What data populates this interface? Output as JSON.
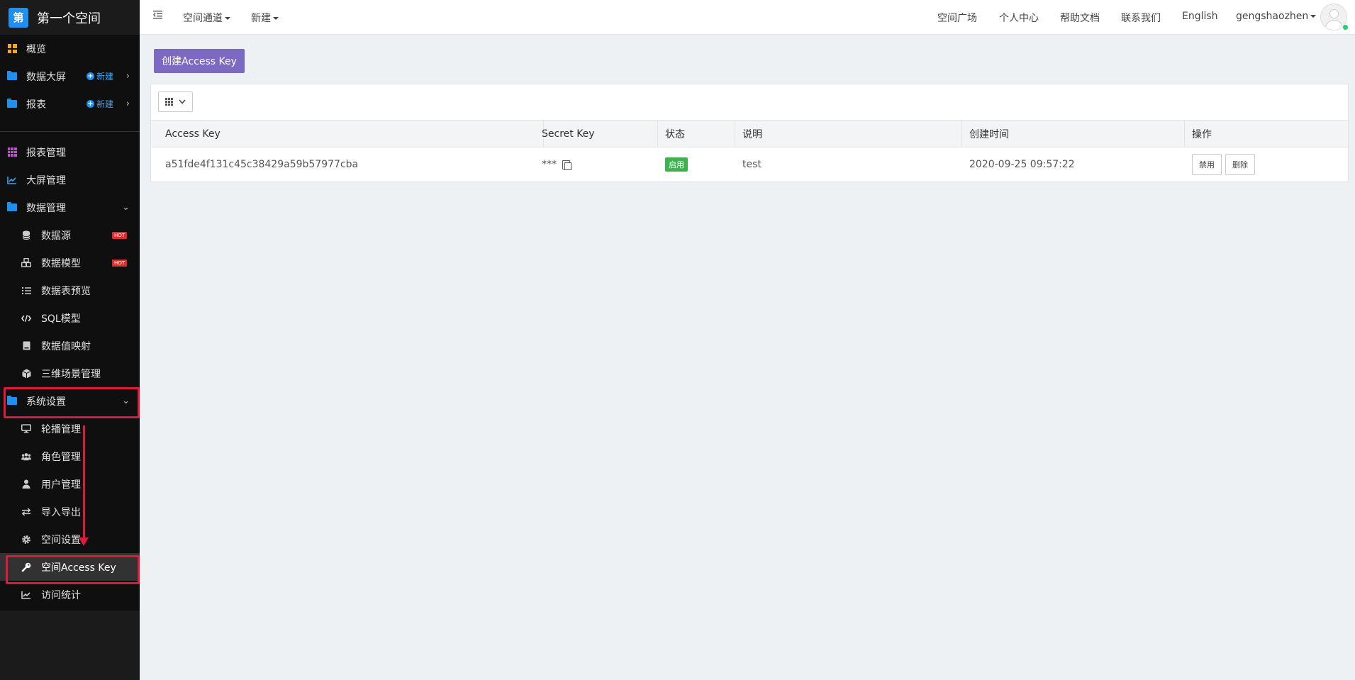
{
  "brand": {
    "logo": "第",
    "name": "第一个空间"
  },
  "sidebar": {
    "new_label": "新建",
    "hot_label": "HOT",
    "items": [
      {
        "label": "概览",
        "icon": "dashboard-grid-icon"
      },
      {
        "label": "数据大屏",
        "icon": "folder-icon"
      },
      {
        "label": "报表",
        "icon": "folder-icon"
      },
      {
        "label": "报表管理",
        "icon": "apps-grid-icon"
      },
      {
        "label": "大屏管理",
        "icon": "line-chart-icon"
      },
      {
        "label": "数据管理",
        "icon": "folder-icon"
      },
      {
        "label": "数据源",
        "icon": "database-icon"
      },
      {
        "label": "数据模型",
        "icon": "cubes-icon"
      },
      {
        "label": "数据表预览",
        "icon": "list-icon"
      },
      {
        "label": "SQL模型",
        "icon": "code-icon"
      },
      {
        "label": "数据值映射",
        "icon": "book-icon"
      },
      {
        "label": "三维场景管理",
        "icon": "cube-icon"
      },
      {
        "label": "系统设置",
        "icon": "folder-icon"
      },
      {
        "label": "轮播管理",
        "icon": "desktop-icon"
      },
      {
        "label": "角色管理",
        "icon": "users-icon"
      },
      {
        "label": "用户管理",
        "icon": "user-icon"
      },
      {
        "label": "导入导出",
        "icon": "exchange-icon"
      },
      {
        "label": "空间设置",
        "icon": "gear-icon"
      },
      {
        "label": "空间Access Key",
        "icon": "key-icon"
      },
      {
        "label": "访问统计",
        "icon": "area-chart-icon"
      }
    ]
  },
  "topbar": {
    "left": [
      "空间通道",
      "新建"
    ],
    "right": [
      "空间广场",
      "个人中心",
      "帮助文档",
      "联系我们",
      "English"
    ],
    "username": "gengshaozhen"
  },
  "main": {
    "create_button": "创建Access Key",
    "table": {
      "headers": [
        "Access Key",
        "Secret Key",
        "状态",
        "说明",
        "创建时间",
        "操作"
      ],
      "rows": [
        {
          "access_key": "a51fde4f131c45c38429a59b57977cba",
          "secret_key": "***",
          "status": "启用",
          "description": "test",
          "created": "2020-09-25 09:57:22",
          "actions": [
            "禁用",
            "删除"
          ]
        }
      ]
    }
  },
  "colors": {
    "accent": "#7c69c4",
    "sidebar_bg": "#0f0f0f",
    "highlight": "#e0193a",
    "status_ok": "#3fb24f"
  }
}
